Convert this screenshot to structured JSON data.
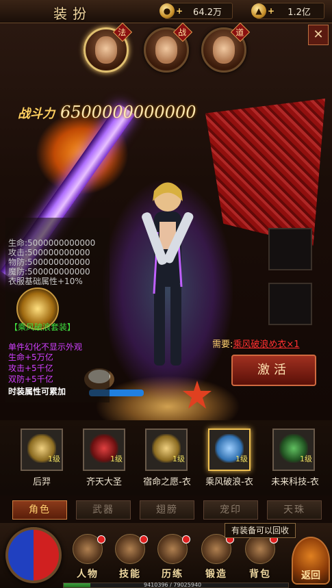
{
  "header": {
    "title": "装扮",
    "gold": "64.2万",
    "ingot": "1.2亿"
  },
  "characters": [
    {
      "badge": "法",
      "selected": true
    },
    {
      "badge": "战",
      "selected": false
    },
    {
      "badge": "道",
      "selected": false
    }
  ],
  "power": {
    "label": "战斗力",
    "value": "6500000000000"
  },
  "stats": {
    "lines": [
      "生命:5000000000000",
      "攻击:500000000000",
      "物防:500000000000",
      "魔防:500000000000",
      "衣服基础属性+10%"
    ],
    "suit_name": "【乘风破浪套装】",
    "bonus_lines": [
      "单件幻化不显示外观",
      "生命+5万亿",
      "攻击+5千亿",
      "双防+5千亿"
    ],
    "stack_note": "时装属性可累加"
  },
  "requirement": {
    "label": "需要:",
    "item": "乘风破浪め衣×1"
  },
  "activate_label": "激活",
  "costumes": [
    {
      "name": "后羿",
      "level": "1级",
      "selected": false
    },
    {
      "name": "齐天大圣",
      "level": "1级",
      "selected": false
    },
    {
      "name": "宿命之愿-衣",
      "level": "1级",
      "selected": false
    },
    {
      "name": "乘风破浪-衣",
      "level": "1级",
      "selected": true
    },
    {
      "name": "未来科技-衣",
      "level": "1级",
      "selected": false
    }
  ],
  "tabs": [
    "角色",
    "武器",
    "翅膀",
    "宠印",
    "天珠"
  ],
  "active_tab": 0,
  "tooltip": "有装备可以回收",
  "nav": [
    "人物",
    "技能",
    "历练",
    "锻造",
    "背包"
  ],
  "back_label": "返回",
  "exp": {
    "text": "9410396 / 79025940",
    "fraction": 0.119
  }
}
